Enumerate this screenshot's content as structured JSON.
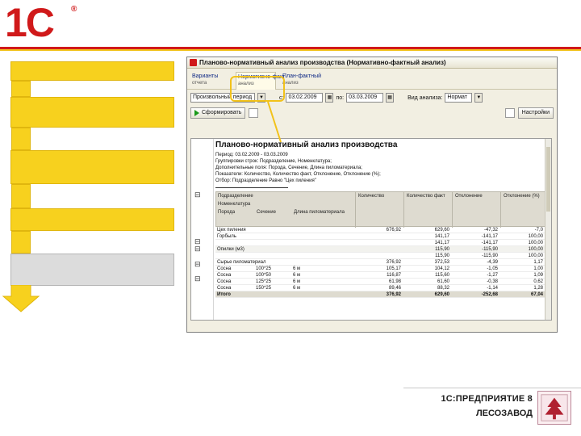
{
  "logo": {
    "text": "1C",
    "mark": "®"
  },
  "window": {
    "title": "Планово-нормативный анализ производства (Нормативно-фактный анализ)",
    "tabs": [
      {
        "label": "Варианты",
        "sub": "отчета"
      },
      {
        "label": "Нормативно-факт",
        "sub": "анализ"
      },
      {
        "label": "План-фактный",
        "sub": "анализ"
      }
    ],
    "period_label": "Произвольный период",
    "from_label": "с:",
    "date_from": "03.02.2009",
    "to_label": "по:",
    "date_to": "03.03.2009",
    "analysis_label": "Вид анализа:",
    "analysis_value": "Нормат",
    "generate_button": "Сформировать",
    "settings_button": "Настройки"
  },
  "report": {
    "title": "Планово-нормативный анализ производства",
    "lines": [
      "Период: 03.02.2009 - 03.03.2009",
      "Группировки строк: Подразделение, Номенклатура;",
      "Дополнительные поля: Порода, Сечение, Длина пиломатериала;",
      "Показатели: Количество, Количество факт, Отклонение, Отклонение (%);",
      "Отбор: Подразделение Равно \"Цех пиления\""
    ],
    "headers": {
      "col1": "Подразделение",
      "col1b": "Номенклатура",
      "col1c1": "Порода",
      "col1c2": "Сечение",
      "col1c3": "Длина пиломатериала",
      "col2": "Количество",
      "col3": "Количество факт",
      "col4": "Отклонение",
      "col5": "Отклонение (%)"
    },
    "rows": [
      {
        "c1": "Цех пиления",
        "c2": "",
        "c3": "",
        "q": "676,92",
        "qf": "629,60",
        "d": "-47,32",
        "p": "-7,0",
        "shade": false
      },
      {
        "c1": "Горбыль",
        "c2": "",
        "c3": "",
        "q": "",
        "qf": "141,17",
        "d": "-141,17",
        "p": "100,00",
        "shade": false
      },
      {
        "c1": "",
        "c2": "",
        "c3": "",
        "q": "",
        "qf": "141,17",
        "d": "-141,17",
        "p": "100,00",
        "shade": false
      },
      {
        "c1": "Опилки (м3)",
        "c2": "",
        "c3": "",
        "q": "",
        "qf": "115,90",
        "d": "-115,90",
        "p": "100,00",
        "shade": true
      },
      {
        "c1": "",
        "c2": "",
        "c3": "",
        "q": "",
        "qf": "115,90",
        "d": "-115,90",
        "p": "100,00",
        "shade": false
      },
      {
        "c1": "Сырье пиломатериал",
        "c2": "",
        "c3": "",
        "q": "376,92",
        "qf": "372,53",
        "d": "-4,39",
        "p": "1,17",
        "shade": false
      },
      {
        "c1": "Сосна",
        "c2": "100*25",
        "c3": "6 м",
        "q": "105,17",
        "qf": "104,12",
        "d": "-1,05",
        "p": "1,00",
        "shade": false
      },
      {
        "c1": "Сосна",
        "c2": "100*50",
        "c3": "6 м",
        "q": "116,87",
        "qf": "115,60",
        "d": "-1,27",
        "p": "1,09",
        "shade": false
      },
      {
        "c1": "Сосна",
        "c2": "125*25",
        "c3": "6 м",
        "q": "61,98",
        "qf": "61,60",
        "d": "-0,38",
        "p": "0,62",
        "shade": false
      },
      {
        "c1": "Сосна",
        "c2": "150*25",
        "c3": "6 м",
        "q": "89,46",
        "qf": "88,32",
        "d": "-1,14",
        "p": "1,28",
        "shade": false
      }
    ],
    "total": {
      "label": "Итого",
      "q": "376,92",
      "qf": "629,60",
      "d": "-252,68",
      "p": "67,04"
    }
  },
  "brand": {
    "line1": "1С:ПРЕДПРИЯТИЕ 8",
    "line2": "ЛЕСОЗАВОД"
  },
  "colors": {
    "red": "#d0191a",
    "yellow": "#f7d11e",
    "grey": "#dcdcdc"
  }
}
